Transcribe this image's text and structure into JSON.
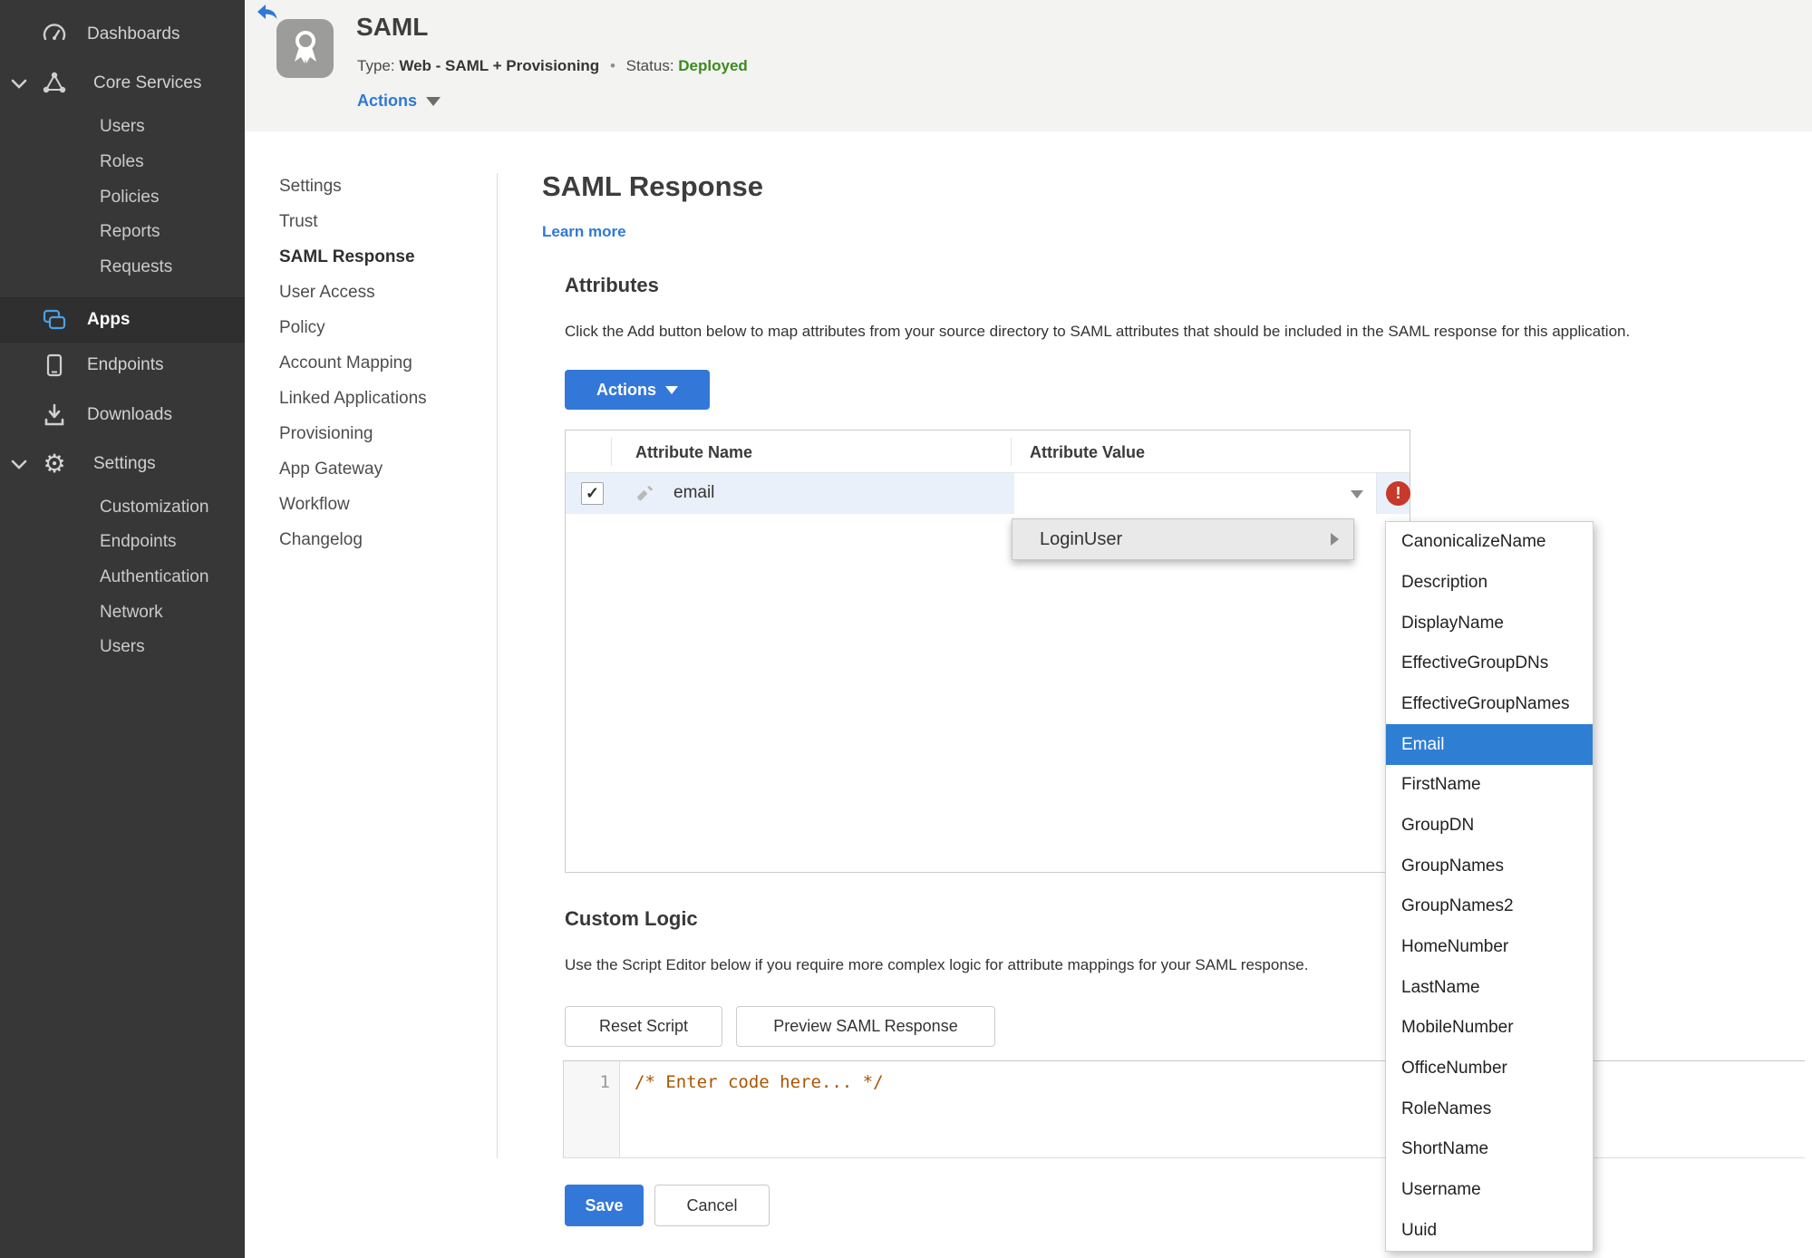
{
  "sidebar": {
    "dashboards": "Dashboards",
    "core_services": "Core Services",
    "core_children": [
      "Users",
      "Roles",
      "Policies",
      "Reports",
      "Requests"
    ],
    "apps": "Apps",
    "endpoints": "Endpoints",
    "downloads": "Downloads",
    "settings": "Settings",
    "settings_children": [
      "Customization",
      "Endpoints",
      "Authentication",
      "Network",
      "Users"
    ]
  },
  "header": {
    "title": "SAML",
    "type_label": "Type:",
    "type_value": "Web - SAML + Provisioning",
    "status_label": "Status:",
    "status_value": "Deployed",
    "actions_label": "Actions"
  },
  "nav": {
    "items": [
      "Settings",
      "Trust",
      "SAML Response",
      "User Access",
      "Policy",
      "Account Mapping",
      "Linked Applications",
      "Provisioning",
      "App Gateway",
      "Workflow",
      "Changelog"
    ],
    "active": "SAML Response"
  },
  "main": {
    "title": "SAML Response",
    "learn_more": "Learn more",
    "attributes": {
      "heading": "Attributes",
      "description": "Click the Add button below to map attributes from your source directory to SAML attributes that should be included in the SAML response for this application.",
      "actions_button": "Actions",
      "table": {
        "columns": [
          "Attribute Name",
          "Attribute Value"
        ],
        "rows": [
          {
            "checked": true,
            "name": "email",
            "value": ""
          }
        ]
      }
    },
    "custom_logic": {
      "heading": "Custom Logic",
      "description": "Use the Script Editor below if you require more complex logic for attribute mappings for your SAML response.",
      "reset_button": "Reset Script",
      "preview_button": "Preview SAML Response",
      "editor": {
        "line_number": "1",
        "code": "/* Enter code here... */"
      }
    },
    "footer": {
      "save": "Save",
      "cancel": "Cancel"
    }
  },
  "dropdown": {
    "parent_item": "LoginUser",
    "selected": "Email",
    "items": [
      "CanonicalizeName",
      "Description",
      "DisplayName",
      "EffectiveGroupDNs",
      "EffectiveGroupNames",
      "Email",
      "FirstName",
      "GroupDN",
      "GroupNames",
      "GroupNames2",
      "HomeNumber",
      "LastName",
      "MobileNumber",
      "OfficeNumber",
      "RoleNames",
      "ShortName",
      "Username",
      "Uuid"
    ]
  },
  "icons": {
    "check": "✓",
    "exclamation": "!",
    "separator_dot": "•",
    "gear": "⚙"
  },
  "colors": {
    "accent_blue": "#3378d8",
    "link_blue": "#2f78d6",
    "status_green": "#3c8a1e",
    "error_red": "#c7392b",
    "row_highlight": "#e9f0f9",
    "menu_selected": "#2e7ed4",
    "sidebar_bg": "#373737"
  }
}
